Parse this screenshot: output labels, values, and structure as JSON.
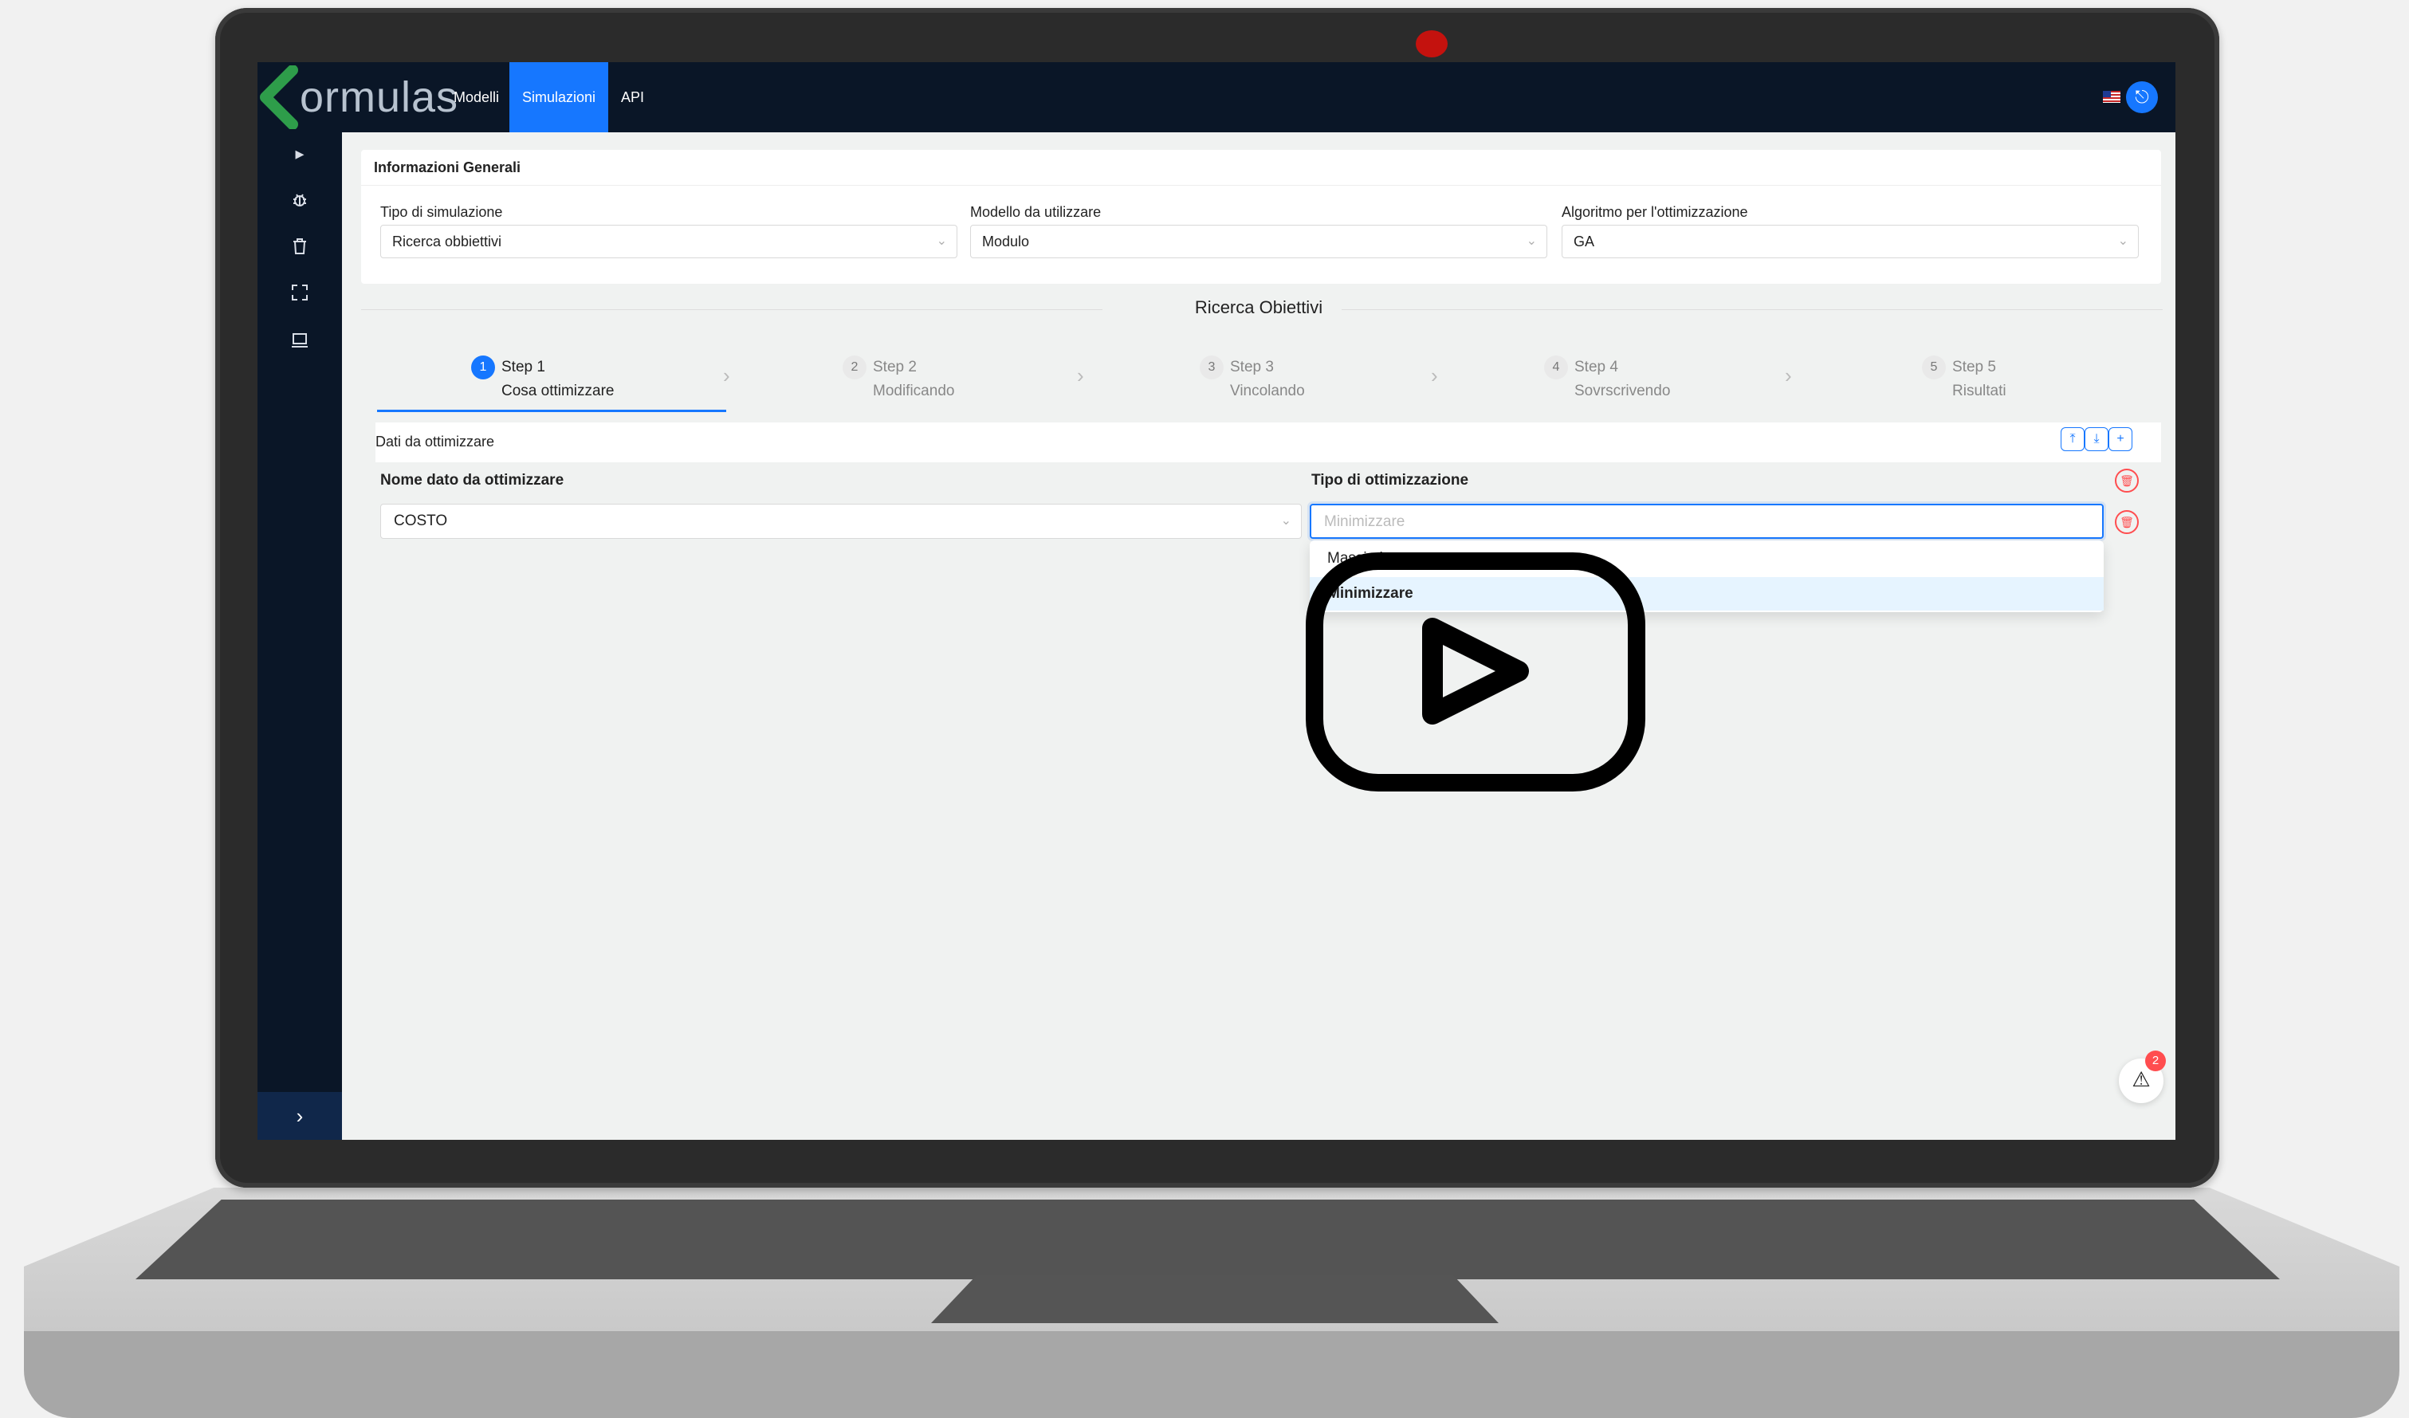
{
  "app": {
    "logo_text": "ormulas",
    "nav": [
      {
        "label": "Modelli",
        "active": false
      },
      {
        "label": "Simulazioni",
        "active": true
      },
      {
        "label": "API",
        "active": false
      }
    ]
  },
  "sidebar": {
    "icons": [
      "caret-right-icon",
      "bug-icon",
      "trash-icon",
      "fullscreen-icon",
      "laptop-icon"
    ],
    "collapse_icon": "chevron-right-icon"
  },
  "general": {
    "title": "Informazioni Generali",
    "fields": [
      {
        "label": "Tipo di simulazione",
        "value": "Ricerca obbiettivi"
      },
      {
        "label": "Modello da utilizzare",
        "value": "Modulo"
      },
      {
        "label": "Algoritmo per l'ottimizzazione",
        "value": "GA"
      }
    ]
  },
  "section_title": "Ricerca Obiettivi",
  "steps": [
    {
      "num": "1",
      "title": "Step 1",
      "sub": "Cosa ottimizzare",
      "active": true
    },
    {
      "num": "2",
      "title": "Step 2",
      "sub": "Modificando",
      "active": false
    },
    {
      "num": "3",
      "title": "Step 3",
      "sub": "Vincolando",
      "active": false
    },
    {
      "num": "4",
      "title": "Step 4",
      "sub": "Sovrscrivendo",
      "active": false
    },
    {
      "num": "5",
      "title": "Step 5",
      "sub": "Risultati",
      "active": false
    }
  ],
  "data_panel": {
    "title": "Dati da ottimizzare",
    "col_name": "Nome dato da ottimizzare",
    "col_type": "Tipo di ottimizzazione",
    "row": {
      "name": "COSTO",
      "type_placeholder": "Minimizzare"
    },
    "options": [
      "Massimizzare",
      "Minimizzare"
    ],
    "selected_option": "Minimizzare"
  },
  "alerts": {
    "count": "2"
  },
  "colors": {
    "accent": "#1677ff",
    "topbar": "#0a1627",
    "danger": "#ff4d4f",
    "logo_green": "#2e9d4a"
  }
}
